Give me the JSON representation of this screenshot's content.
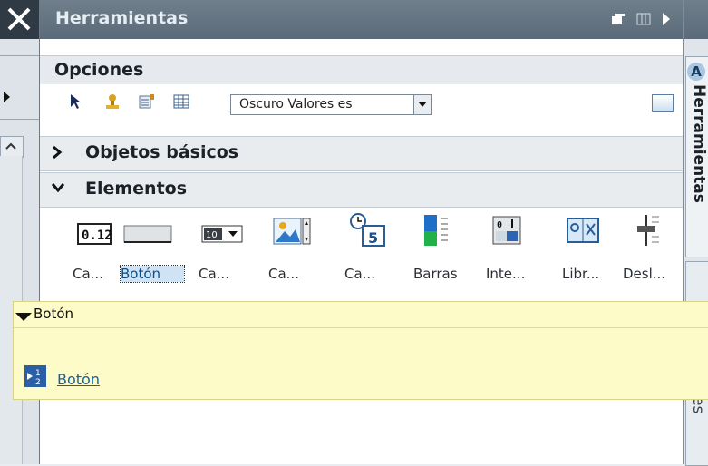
{
  "panel": {
    "title": "Herramientas",
    "options_header": "Opciones"
  },
  "toolbar": {
    "dropdown_value": "Oscuro Valores es"
  },
  "sections": {
    "basic": "Objetos básicos",
    "elements": "Elementos"
  },
  "elements": [
    {
      "label": "Ca...",
      "icon": "io-field-icon"
    },
    {
      "label": "Botón",
      "icon": "button-icon",
      "selected": true
    },
    {
      "label": "Ca...",
      "icon": "symbolic-io-icon"
    },
    {
      "label": "Ca...",
      "icon": "graphic-io-icon"
    },
    {
      "label": "Ca...",
      "icon": "date-time-icon"
    },
    {
      "label": "Barras",
      "icon": "bar-icon"
    },
    {
      "label": "Inte...",
      "icon": "switch-icon"
    },
    {
      "label": "Libr...",
      "icon": "symbol-library-icon"
    },
    {
      "label": "Desl...",
      "icon": "slider-icon"
    }
  ],
  "right_strip": {
    "tab_letter": "A",
    "tab_label": "Herramientas",
    "tab2_label": "es"
  },
  "tooltip": {
    "title": "Botón",
    "link": "Botón"
  }
}
